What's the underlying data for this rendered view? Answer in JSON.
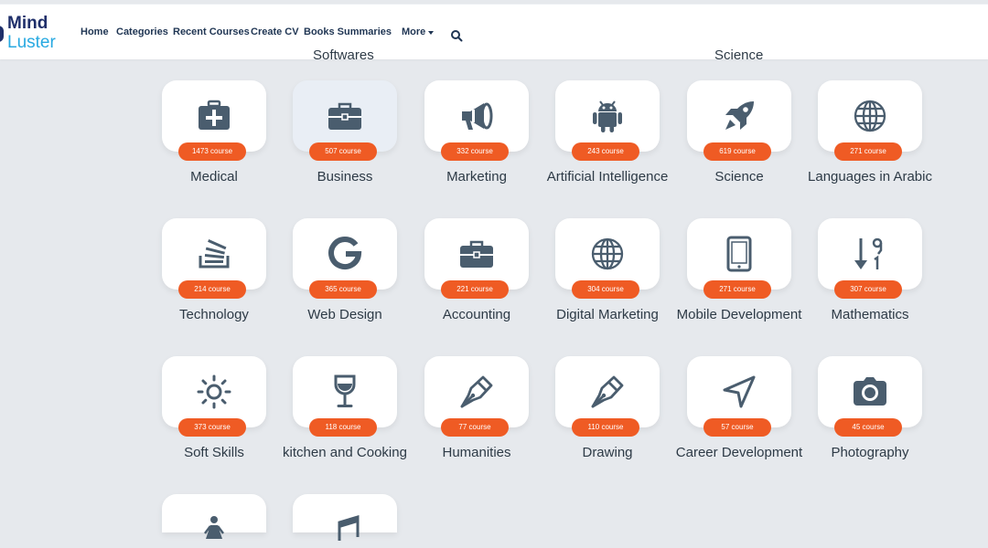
{
  "brand": {
    "line1": "Mind",
    "line2": "Luster"
  },
  "nav": {
    "items": [
      "Home",
      "Categories",
      "Recent Courses",
      "Create CV",
      "Books Summaries",
      "More"
    ]
  },
  "cut_labels": [
    "Softwares",
    "Science"
  ],
  "categories": [
    {
      "name": "Medical",
      "count": "1473 course",
      "icon": "medical-kit-icon"
    },
    {
      "name": "Business",
      "count": "507 course",
      "icon": "briefcase-icon"
    },
    {
      "name": "Marketing",
      "count": "332 course",
      "icon": "megaphone-icon"
    },
    {
      "name": "Artificial Intelligence",
      "count": "243 course",
      "icon": "android-icon"
    },
    {
      "name": "Science",
      "count": "619 course",
      "icon": "rocket-icon"
    },
    {
      "name": "Languages in Arabic",
      "count": "271 course",
      "icon": "globe-icon"
    },
    {
      "name": "Technology",
      "count": "214 course",
      "icon": "stack-icon"
    },
    {
      "name": "Web Design",
      "count": "365 course",
      "icon": "google-icon"
    },
    {
      "name": "Accounting",
      "count": "221 course",
      "icon": "toolbox-icon"
    },
    {
      "name": "Digital Marketing",
      "count": "304 course",
      "icon": "globe-icon"
    },
    {
      "name": "Mobile Development",
      "count": "271 course",
      "icon": "tablet-icon"
    },
    {
      "name": "Mathematics",
      "count": "307 course",
      "icon": "sort-numeric-icon"
    },
    {
      "name": "Soft Skills",
      "count": "373 course",
      "icon": "sun-icon"
    },
    {
      "name": "kitchen and Cooking",
      "count": "118 course",
      "icon": "wine-glass-icon"
    },
    {
      "name": "Humanities",
      "count": "77 course",
      "icon": "pen-nib-icon"
    },
    {
      "name": "Drawing",
      "count": "110 course",
      "icon": "pen-nib-icon"
    },
    {
      "name": "Career Development",
      "count": "57 course",
      "icon": "location-arrow-icon"
    },
    {
      "name": "Photography",
      "count": "45 course",
      "icon": "camera-icon"
    },
    {
      "name": "",
      "count": "",
      "icon": "female-icon"
    },
    {
      "name": "",
      "count": "",
      "icon": "music-icon"
    }
  ],
  "colors": {
    "badge": "#ef5b24",
    "icon": "#4a5d6e",
    "background": "#e6e9ed",
    "brand_dark": "#1f2f6a",
    "brand_light": "#27a9e1"
  }
}
